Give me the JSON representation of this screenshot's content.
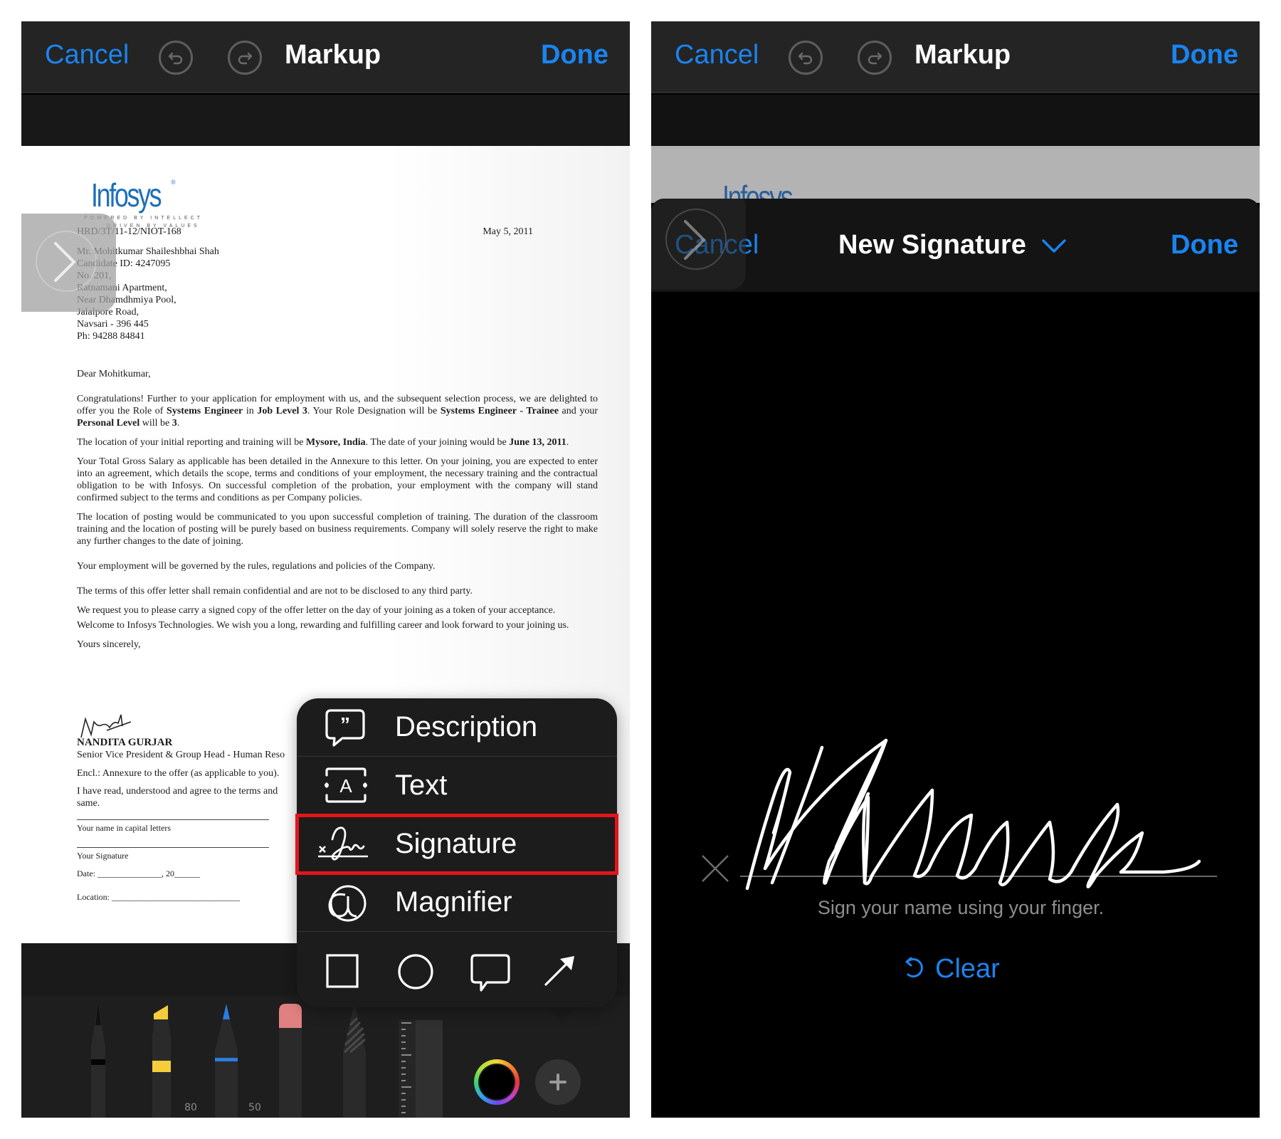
{
  "left": {
    "nav": {
      "cancel_label": "Cancel",
      "title": "Markup",
      "done_label": "Done",
      "undo_icon": "undo-icon",
      "redo_icon": "redo-icon"
    },
    "document": {
      "logo": "Infosys",
      "logo_tagline_1": "POWERED BY INTELLECT",
      "logo_tagline_2": "DRIVEN BY VALUES",
      "reference": "HRD/3T/11-12/NIOT-168",
      "date": "May 5, 2011",
      "address": [
        "Mr. Mohitkumar Shaileshbhai Shah",
        "Candidate ID: 4247095",
        "No. 201,",
        "Ratnamani Apartment,",
        "Near Dhamdhmiya Pool,",
        "Jalalpore Road,",
        "Navsari - 396 445",
        "Ph: 94288 84841"
      ],
      "salutation": "Dear Mohitkumar,",
      "paragraphs": [
        "Congratulations! Further to your application for employment with us, and the subsequent selection process, we are delighted to offer you the Role of Systems Engineer in Job Level 3. Your Role Designation will be Systems Engineer - Trainee and your Personal Level will be 3.",
        "The location of your initial reporting and training will be Mysore, India. The date of your joining would be June 13, 2011.",
        "Your Total Gross Salary as applicable has been detailed in the Annexure to this letter. On your joining, you are expected to enter into an agreement, which details the scope, terms and conditions of your employment, the necessary training and the contractual obligation to be with Infosys. On successful completion of the probation, your employment with the company will stand confirmed subject to the terms and conditions as per Company policies.",
        "The location of posting would be communicated to you upon successful completion of training. The duration of the classroom training and the location of posting will be purely based on business requirements. Company will solely reserve the right to make any further changes to the date of joining.",
        "Your employment will be governed by the rules, regulations and policies of the Company.",
        "The terms of this offer letter shall remain confidential and are not to be disclosed to any third party.",
        "We request you to please carry a signed copy of the offer letter on the day of your joining as a token of your acceptance.",
        "Welcome to Infosys Technologies. We wish you a long, rewarding and fulfilling career and look forward to your joining us."
      ],
      "closing": "Yours sincerely,",
      "signer_name": "NANDITA GURJAR",
      "signer_title": "Senior Vice President & Group Head - Human Reso",
      "enclosure": "Encl.: Annexure to the offer (as applicable to you).",
      "agreement": "I have read, understood and agree to the terms and",
      "agreement_cont": "same.",
      "name_label": "Your name in capital letters",
      "signature_label": "Your Signature",
      "date_label": "Date: _______________, 20______",
      "location_label": "Location: ______________________________"
    },
    "popup_menu": {
      "items": [
        {
          "label": "Description",
          "icon": "quote-bubble-icon"
        },
        {
          "label": "Text",
          "icon": "text-box-icon"
        },
        {
          "label": "Signature",
          "icon": "signature-icon",
          "highlighted": true
        },
        {
          "label": "Magnifier",
          "icon": "magnifier-icon"
        }
      ],
      "shapes": [
        "square-icon",
        "circle-icon",
        "speech-bubble-icon",
        "arrow-icon"
      ]
    },
    "toolbar": {
      "tools": [
        {
          "name": "pen",
          "label": ""
        },
        {
          "name": "highlighter",
          "label": "80",
          "color": "#f5cd3b"
        },
        {
          "name": "pencil",
          "label": "50",
          "color": "#2a7de1"
        },
        {
          "name": "eraser",
          "label": "",
          "color": "#e08080"
        },
        {
          "name": "lasso",
          "label": ""
        },
        {
          "name": "ruler",
          "label": ""
        }
      ],
      "selected_color": "#000000"
    }
  },
  "right": {
    "nav": {
      "cancel_label": "Cancel",
      "title": "Markup",
      "done_label": "Done"
    },
    "background_logo": "Infosys",
    "signature_sheet": {
      "cancel_label": "Cancel",
      "title": "New Signature",
      "done_label": "Done",
      "hint": "Sign your name using your finger.",
      "clear_label": "Clear"
    }
  },
  "colors": {
    "accent": "#1a84f0",
    "highlight_box": "#e4141b",
    "nav_bg": "#242424"
  }
}
